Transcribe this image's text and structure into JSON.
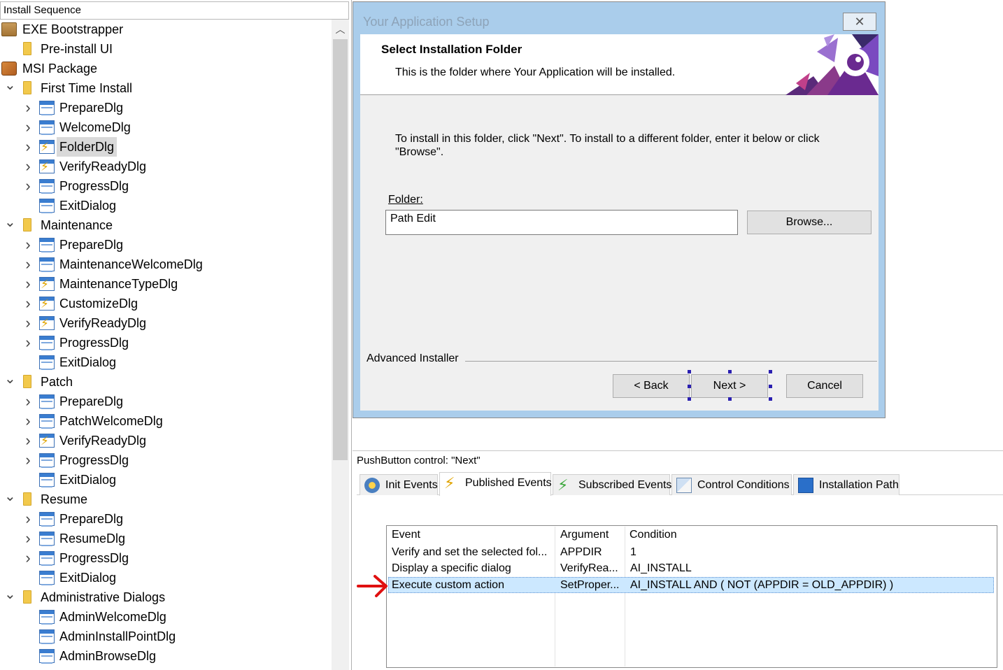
{
  "tree": {
    "header": "Install Sequence",
    "items": [
      {
        "label": "EXE Bootstrapper",
        "icon": "package-icon",
        "level": 0,
        "expander": false
      },
      {
        "label": "Pre-install UI",
        "icon": "folder-icon",
        "level": 1,
        "expander": false
      },
      {
        "label": "MSI Package",
        "icon": "msi-package-icon",
        "level": 0,
        "expander": false
      },
      {
        "label": "First Time Install",
        "icon": "folder-icon",
        "level": 1,
        "expander": "expanded"
      },
      {
        "label": "PrepareDlg",
        "icon": "dialog-icon",
        "level": 2,
        "expander": "collapsed"
      },
      {
        "label": "WelcomeDlg",
        "icon": "dialog-icon",
        "level": 2,
        "expander": "collapsed"
      },
      {
        "label": "FolderDlg",
        "icon": "dialog-events-icon",
        "level": 2,
        "expander": "collapsed",
        "selected": true
      },
      {
        "label": "VerifyReadyDlg",
        "icon": "dialog-events-icon",
        "level": 2,
        "expander": "collapsed"
      },
      {
        "label": "ProgressDlg",
        "icon": "dialog-icon",
        "level": 2,
        "expander": "collapsed"
      },
      {
        "label": "ExitDialog",
        "icon": "dialog-icon",
        "level": 2,
        "expander": false
      },
      {
        "label": "Maintenance",
        "icon": "folder-icon",
        "level": 1,
        "expander": "expanded"
      },
      {
        "label": "PrepareDlg",
        "icon": "dialog-icon",
        "level": 2,
        "expander": "collapsed"
      },
      {
        "label": "MaintenanceWelcomeDlg",
        "icon": "dialog-icon",
        "level": 2,
        "expander": "collapsed"
      },
      {
        "label": "MaintenanceTypeDlg",
        "icon": "dialog-events-icon",
        "level": 2,
        "expander": "collapsed"
      },
      {
        "label": "CustomizeDlg",
        "icon": "dialog-events-icon",
        "level": 2,
        "expander": "collapsed"
      },
      {
        "label": "VerifyReadyDlg",
        "icon": "dialog-events-icon",
        "level": 2,
        "expander": "collapsed"
      },
      {
        "label": "ProgressDlg",
        "icon": "dialog-icon",
        "level": 2,
        "expander": "collapsed"
      },
      {
        "label": "ExitDialog",
        "icon": "dialog-icon",
        "level": 2,
        "expander": false
      },
      {
        "label": "Patch",
        "icon": "folder-icon",
        "level": 1,
        "expander": "expanded"
      },
      {
        "label": "PrepareDlg",
        "icon": "dialog-icon",
        "level": 2,
        "expander": "collapsed"
      },
      {
        "label": "PatchWelcomeDlg",
        "icon": "dialog-icon",
        "level": 2,
        "expander": "collapsed"
      },
      {
        "label": "VerifyReadyDlg",
        "icon": "dialog-events-icon",
        "level": 2,
        "expander": "collapsed"
      },
      {
        "label": "ProgressDlg",
        "icon": "dialog-icon",
        "level": 2,
        "expander": "collapsed"
      },
      {
        "label": "ExitDialog",
        "icon": "dialog-icon",
        "level": 2,
        "expander": false
      },
      {
        "label": "Resume",
        "icon": "folder-icon",
        "level": 1,
        "expander": "expanded"
      },
      {
        "label": "PrepareDlg",
        "icon": "dialog-icon",
        "level": 2,
        "expander": "collapsed"
      },
      {
        "label": "ResumeDlg",
        "icon": "dialog-icon",
        "level": 2,
        "expander": "collapsed"
      },
      {
        "label": "ProgressDlg",
        "icon": "dialog-icon",
        "level": 2,
        "expander": "collapsed"
      },
      {
        "label": "ExitDialog",
        "icon": "dialog-icon",
        "level": 2,
        "expander": false
      },
      {
        "label": "Administrative Dialogs",
        "icon": "folder-icon",
        "level": 1,
        "expander": "expanded"
      },
      {
        "label": "AdminWelcomeDlg",
        "icon": "dialog-icon",
        "level": 2,
        "expander": false
      },
      {
        "label": "AdminInstallPointDlg",
        "icon": "dialog-icon",
        "level": 2,
        "expander": false
      },
      {
        "label": "AdminBrowseDlg",
        "icon": "dialog-icon",
        "level": 2,
        "expander": false
      }
    ]
  },
  "dialog": {
    "title": "Your Application Setup",
    "close_glyph": "✕",
    "banner_title": "Select Installation Folder",
    "banner_subtitle": "This is the folder where Your Application will be installed.",
    "instructions": "To install in this folder, click \"Next\". To install to a different folder, enter it below or click \"Browse\".",
    "folder_label": "Folder:",
    "path_value": "Path Edit",
    "browse_label": "Browse...",
    "brand": "Advanced Installer",
    "back_label": "< Back",
    "next_label": "Next >",
    "cancel_label": "Cancel"
  },
  "properties": {
    "title": "PushButton control: \"Next\"",
    "tabs": [
      {
        "label": "Init Events",
        "icon": "init-events-icon"
      },
      {
        "label": "Published Events",
        "icon": "published-events-icon",
        "active": true
      },
      {
        "label": "Subscribed Events",
        "icon": "subscribed-events-icon"
      },
      {
        "label": "Control Conditions",
        "icon": "control-conditions-icon"
      },
      {
        "label": "Installation Path",
        "icon": "installation-path-icon"
      }
    ],
    "table": {
      "columns": [
        "Event",
        "Argument",
        "Condition"
      ],
      "rows": [
        {
          "event": "Verify and set the selected fol...",
          "argument": "APPDIR",
          "condition": "1"
        },
        {
          "event": "Display a specific dialog",
          "argument": "VerifyRea...",
          "condition": "AI_INSTALL"
        },
        {
          "event": "Execute custom action",
          "argument": "SetProper...",
          "condition": "AI_INSTALL AND ( NOT (APPDIR = OLD_APPDIR) )",
          "selected": true
        }
      ]
    }
  },
  "colors": {
    "dialog_frame": "#aacdeb",
    "selection": "#cce8ff",
    "arrow": "#e01010"
  }
}
